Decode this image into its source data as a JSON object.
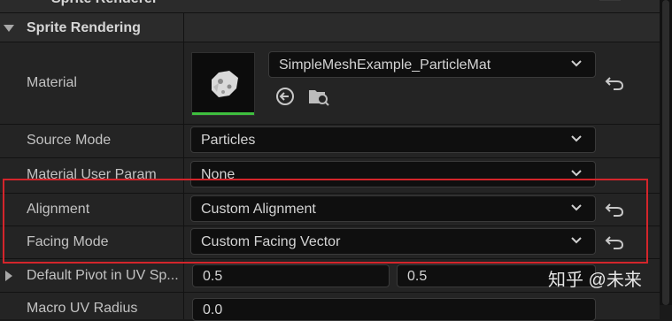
{
  "top_row": {
    "title": "Sprite Renderer"
  },
  "section": {
    "title": "Sprite Rendering"
  },
  "material": {
    "label": "Material",
    "value": "SimpleMeshExample_ParticleMat"
  },
  "source_mode": {
    "label": "Source Mode",
    "value": "Particles"
  },
  "material_user_param": {
    "label": "Material User Param",
    "value": "None"
  },
  "alignment": {
    "label": "Alignment",
    "value": "Custom Alignment"
  },
  "facing_mode": {
    "label": "Facing Mode",
    "value": "Custom Facing Vector"
  },
  "default_pivot": {
    "label": "Default Pivot in UV Sp...",
    "x": "0.5",
    "y": "0.5"
  },
  "macro_uv": {
    "label": "Macro UV Radius",
    "value": "0.0"
  },
  "watermark": "知乎 @未来"
}
